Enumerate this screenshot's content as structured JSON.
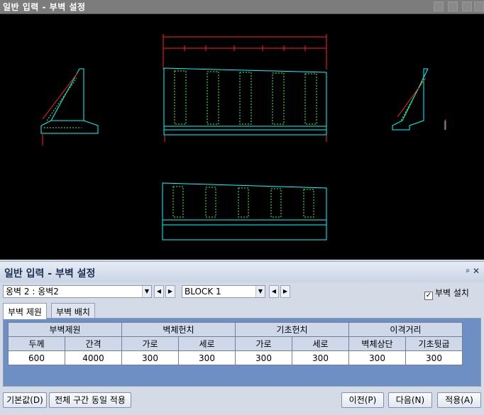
{
  "window": {
    "title": "일반 입력 - 부벽 설정"
  },
  "panel": {
    "title": "일반 입력 - 부벽 설정",
    "pin_glyph": "ᵖ",
    "close_glyph": "✕"
  },
  "selectors": {
    "wall": "옹벽 2 : 옹벽2",
    "block": "BLOCK  1",
    "arrow_glyph": "▼",
    "prev_glyph": "◀",
    "next_glyph": "▶"
  },
  "checkbox": {
    "label": "부벽 설치",
    "checked": true,
    "glyph": "✓"
  },
  "tabs": [
    {
      "label": "부벽 제원"
    },
    {
      "label": "부벽 배치"
    }
  ],
  "table": {
    "groups": [
      "부벽제원",
      "벽체헌치",
      "기초헌치",
      "이격거리"
    ],
    "columns": [
      "두께",
      "간격",
      "가로",
      "세로",
      "가로",
      "세로",
      "벽체상단",
      "기초뒷굽"
    ],
    "row": [
      "600",
      "4000",
      "300",
      "300",
      "300",
      "300",
      "300",
      "300"
    ]
  },
  "buttons": {
    "default": "기본값(D)",
    "apply_all": "전체 구간 동일 적용",
    "prev": "이전(P)",
    "next": "다음(N)",
    "apply": "적용(A)"
  },
  "colors": {
    "canvas_bg": "#000000",
    "outline": "#00ffff",
    "dimension": "#ff2020",
    "rebar": "#40ff40",
    "text": "#ffff00"
  }
}
